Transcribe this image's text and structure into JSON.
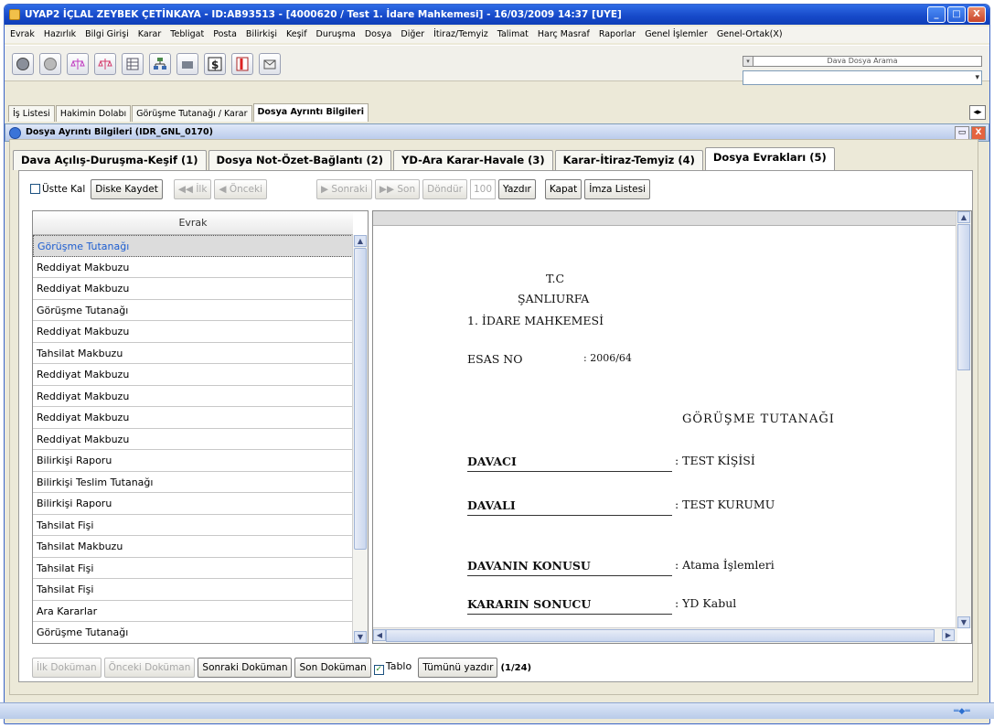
{
  "window": {
    "title": "UYAP2  İÇLAL ZEYBEK ÇETİNKAYA  - ID:AB93513 - [4000620 / Test 1. İdare Mahkemesi] - 16/03/2009 14:37 [UYE]",
    "min_label": "_",
    "max_label": "□",
    "close_label": "X"
  },
  "menu": [
    "Evrak",
    "Hazırlık",
    "Bilgi Girişi",
    "Karar",
    "Tebligat",
    "Posta",
    "Bilirkişi",
    "Keşif",
    "Duruşma",
    "Dosya",
    "Diğer",
    "İtiraz/Temyiz",
    "Talimat",
    "Harç Masraf",
    "Raporlar",
    "Genel İşlemler",
    "Genel-Ortak(X)"
  ],
  "search": {
    "label": "Dava Dosya Arama",
    "dropdown_marker": "▾",
    "arrow": "▾"
  },
  "worktabs": [
    "İş Listesi",
    "Hakimin Dolabı",
    "Görüşme Tutanağı / Karar",
    "Dosya Ayrıntı Bilgileri"
  ],
  "worktab_nav": "◂▸",
  "inner": {
    "title": "Dosya Ayrıntı Bilgileri (IDR_GNL_0170)",
    "restore": "▭",
    "close": "X"
  },
  "tabs": [
    "Dava Açılış-Duruşma-Keşif (1)",
    "Dosya Not-Özet-Bağlantı (2)",
    "YD-Ara Karar-Havale (3)",
    "Karar-İtiraz-Temyiz (4)",
    "Dosya Evrakları (5)"
  ],
  "toolbar": {
    "ustte_kal": "Üstte Kal",
    "diske_kaydet": "Diske Kaydet",
    "ilk": "◀◀ İlk",
    "onceki": "◀ Önceki",
    "sonraki": "▶ Sonraki",
    "son": "▶▶ Son",
    "dondur": "Döndür",
    "zoom": "100",
    "yazdir": "Yazdır",
    "kapat": "Kapat",
    "imza": "İmza Listesi"
  },
  "list": {
    "header": "Evrak",
    "items": [
      "Görüşme Tutanağı",
      "Reddiyat Makbuzu",
      "Reddiyat Makbuzu",
      "Görüşme Tutanağı",
      "Reddiyat Makbuzu",
      "Tahsilat Makbuzu",
      "Reddiyat Makbuzu",
      "Reddiyat Makbuzu",
      "Reddiyat Makbuzu",
      "Reddiyat Makbuzu",
      "Bilirkişi Raporu",
      "Bilirkişi Teslim Tutanağı",
      "Bilirkişi Raporu",
      "Tahsilat Fişi",
      "Tahsilat Makbuzu",
      "Tahsilat Fişi",
      "Tahsilat Fişi",
      "Ara Kararlar",
      "Görüşme Tutanağı"
    ],
    "selected": 0
  },
  "document": {
    "tc": "T.C",
    "city": "ŞANLIURFA",
    "court": "1. İDARE MAHKEMESİ",
    "esas_label": "ESAS NO",
    "esas_value": ": 2006/64",
    "doc_title": "GÖRÜŞME   TUTANAĞI",
    "rows": [
      {
        "label": "DAVACI",
        "value": ": TEST KİŞİSİ"
      },
      {
        "label": "DAVALI",
        "value": ": TEST KURUMU"
      },
      {
        "label": "DAVANIN KONUSU",
        "value": ": Atama İşlemleri"
      },
      {
        "label": "KARARIN SONUCU",
        "value": ": YD Kabul"
      }
    ]
  },
  "bottom": {
    "ilk_dok": "İlk Doküman",
    "onceki_dok": "Önceki Doküman",
    "sonraki_dok": "Sonraki Doküman",
    "son_dok": "Son Doküman",
    "tablo": "Tablo",
    "tumunu": "Tümünü yazdır",
    "count": "(1/24)"
  }
}
